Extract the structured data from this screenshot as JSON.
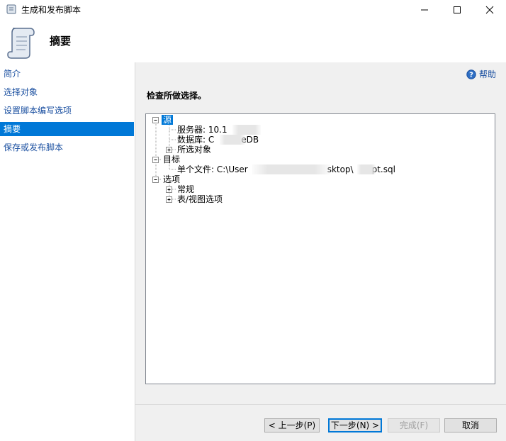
{
  "window": {
    "title": "生成和发布脚本"
  },
  "header": {
    "title": "摘要"
  },
  "sidebar": {
    "items": [
      {
        "label": "简介",
        "selected": false
      },
      {
        "label": "选择对象",
        "selected": false
      },
      {
        "label": "设置脚本编写选项",
        "selected": false
      },
      {
        "label": "摘要",
        "selected": true
      },
      {
        "label": "保存或发布脚本",
        "selected": false
      }
    ]
  },
  "help": {
    "label": "帮助"
  },
  "content": {
    "section_title": "检查所做选择。"
  },
  "tree": {
    "source": {
      "label": "源",
      "server": "服务器: 10.1",
      "database": "数据库: C",
      "database_suffix": "eDB",
      "selected_objects": "所选对象"
    },
    "target": {
      "label": "目标",
      "single_file_prefix": "单个文件: C:\\User",
      "single_file_mid": "sktop\\",
      "single_file_suffix": "pt.sql"
    },
    "options": {
      "label": "选项",
      "general": "常规",
      "table_view": "表/视图选项"
    }
  },
  "buttons": {
    "prev": "< 上一步(P)",
    "next": "下一步(N) >",
    "finish": "完成(F)",
    "cancel": "取消"
  },
  "colors": {
    "selection": "#0078d7",
    "link": "#1a4fa0",
    "panel": "#f0f0f0"
  }
}
